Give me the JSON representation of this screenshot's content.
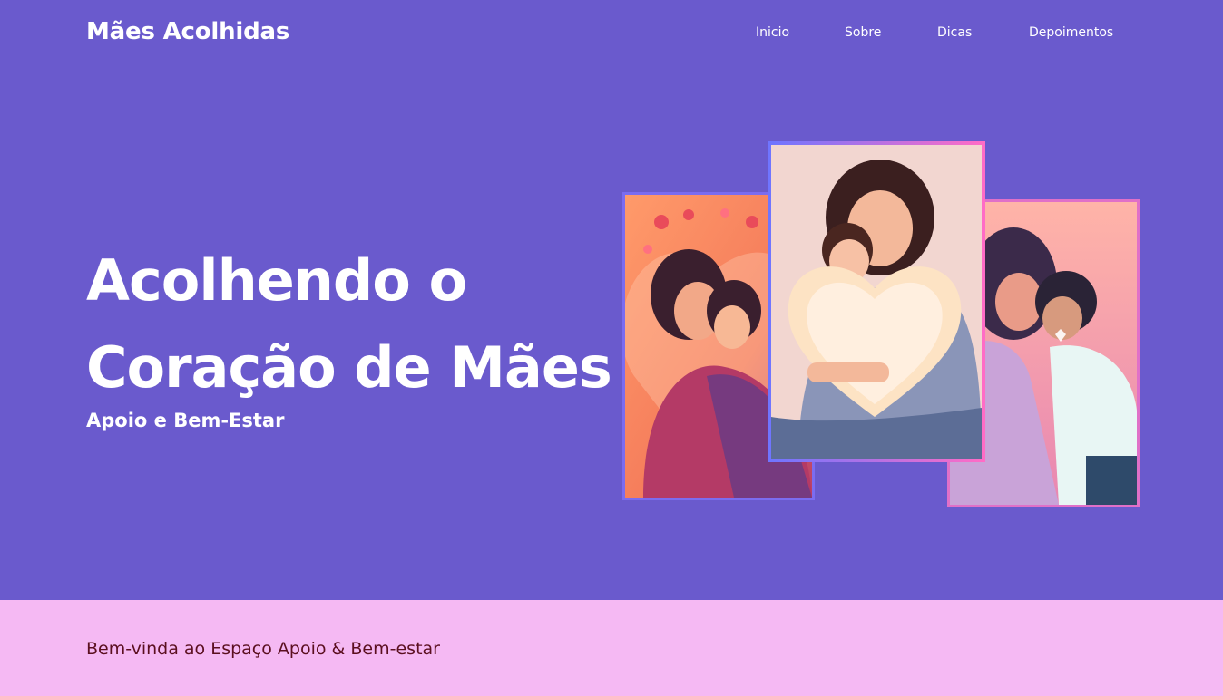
{
  "header": {
    "brand": "Mães Acolhidas",
    "nav": [
      "Inicio",
      "Sobre",
      "Dicas",
      "Depoimentos"
    ]
  },
  "hero": {
    "headline_line1": "Acolhendo o",
    "headline_line2": "Coração de Mães",
    "subhead": "Apoio e Bem-Estar"
  },
  "welcome": {
    "text": "Bem-vinda ao Espaço Apoio & Bem-estar"
  },
  "colors": {
    "hero_bg": "#6a5acd",
    "band_bg": "#f5b9f3",
    "band_text": "#5b0f1f"
  }
}
